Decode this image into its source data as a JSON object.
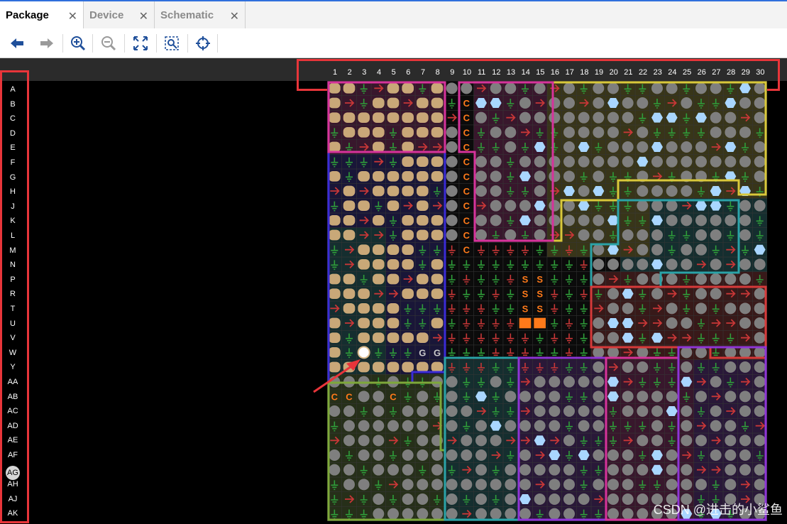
{
  "tabs": [
    {
      "label": "Package",
      "active": true
    },
    {
      "label": "Device",
      "active": false
    },
    {
      "label": "Schematic",
      "active": false
    }
  ],
  "toolbar": [
    {
      "name": "back-arrow-icon"
    },
    {
      "name": "forward-arrow-icon"
    },
    {
      "name": "zoom-in-icon"
    },
    {
      "name": "zoom-out-icon"
    },
    {
      "name": "fit-view-icon"
    },
    {
      "name": "zoom-selection-icon"
    },
    {
      "name": "crosshair-icon"
    }
  ],
  "columns": [
    "1",
    "2",
    "3",
    "4",
    "5",
    "6",
    "7",
    "8",
    "9",
    "10",
    "11",
    "12",
    "13",
    "14",
    "15",
    "16",
    "17",
    "18",
    "19",
    "20",
    "21",
    "22",
    "23",
    "24",
    "25",
    "26",
    "27",
    "28",
    "29",
    "30"
  ],
  "rows": [
    "A",
    "B",
    "C",
    "D",
    "E",
    "F",
    "G",
    "H",
    "J",
    "K",
    "L",
    "M",
    "N",
    "P",
    "R",
    "T",
    "U",
    "V",
    "W",
    "Y",
    "AA",
    "AB",
    "AC",
    "AD",
    "AE",
    "AF",
    "AG",
    "AH",
    "AJ",
    "AK"
  ],
  "selected_row": "AG",
  "pin_letters": {
    "c": "C",
    "s": "S",
    "g": "G"
  },
  "colors": {
    "highlight": "#e8353a",
    "ground": "#2f9e3a",
    "power": "#c83737",
    "io": "#7f7f7f",
    "mgt": "#a9d6ff",
    "config": "#ff7a1a",
    "bank_olive": "#d9c83a",
    "bank_magenta": "#d6339b",
    "bank_blue": "#3a2bd6",
    "bank_teal": "#2aa3a8",
    "bank_green": "#7ea83a",
    "bank_red": "#d63a3a",
    "bank_purple": "#8e35d6"
  },
  "watermark": "CSDN @进击的小鲨鱼"
}
